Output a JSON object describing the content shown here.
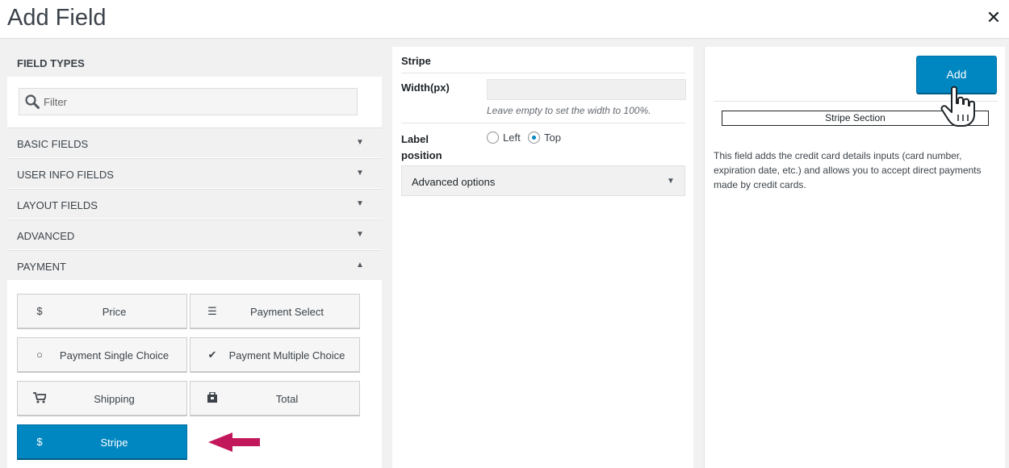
{
  "header": {
    "title": "Add Field",
    "close_icon": "close-icon"
  },
  "field_types": {
    "header": "FIELD TYPES",
    "filter_placeholder": "Filter",
    "sections": [
      {
        "label": "BASIC FIELDS",
        "expanded": false
      },
      {
        "label": "USER INFO FIELDS",
        "expanded": false
      },
      {
        "label": "LAYOUT FIELDS",
        "expanded": false
      },
      {
        "label": "ADVANCED",
        "expanded": false
      },
      {
        "label": "PAYMENT",
        "expanded": true
      }
    ],
    "payment_buttons": [
      {
        "label": "Price",
        "icon": "dollar-icon",
        "glyph": "$"
      },
      {
        "label": "Payment Select",
        "icon": "list-icon",
        "glyph": "☰"
      },
      {
        "label": "Payment Single Choice",
        "icon": "circle-icon",
        "glyph": "○"
      },
      {
        "label": "Payment Multiple Choice",
        "icon": "checkmark-icon",
        "glyph": "✔"
      },
      {
        "label": "Shipping",
        "icon": "cart-icon",
        "glyph": "🛒"
      },
      {
        "label": "Total",
        "icon": "bag-icon",
        "glyph": "▣"
      },
      {
        "label": "Stripe",
        "icon": "dollar-icon",
        "glyph": "$",
        "active": true
      }
    ]
  },
  "settings": {
    "field_name": "Stripe",
    "width_label": "Width(px)",
    "width_value": "",
    "width_help": "Leave empty to set the width to 100%.",
    "label_position_label": "Label position",
    "label_position_options": [
      "Left",
      "Top"
    ],
    "label_position_selected": "Top",
    "advanced_options_label": "Advanced options"
  },
  "preview": {
    "add_button": "Add",
    "preview_label": "Stripe Section",
    "description": "This field adds the credit card details inputs (card number, expiration date, etc.) and allows you to accept direct payments made by credit cards."
  },
  "colors": {
    "accent": "#0086c1",
    "arrow": "#c2185b"
  }
}
